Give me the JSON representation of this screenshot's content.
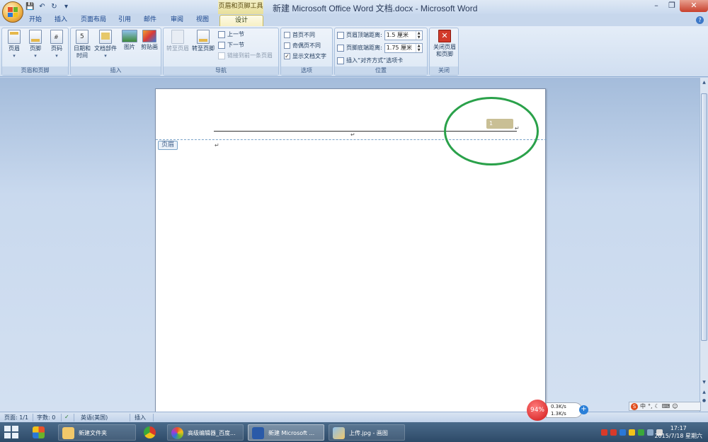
{
  "title_bar": {
    "contextual_tab_label": "页眉和页脚工具",
    "window_title": "新建 Microsoft Office Word 文档.docx - Microsoft Word",
    "minimize": "–",
    "restore": "❐",
    "close": "✕"
  },
  "quick_access": {
    "save": "💾",
    "undo": "↶",
    "redo": "↻",
    "customize": "▾"
  },
  "tabs": [
    {
      "label": "开始"
    },
    {
      "label": "插入"
    },
    {
      "label": "页面布局"
    },
    {
      "label": "引用"
    },
    {
      "label": "邮件"
    },
    {
      "label": "审阅"
    },
    {
      "label": "视图"
    },
    {
      "label": "设计",
      "active": true
    }
  ],
  "ribbon": {
    "header_footer_group": {
      "label": "页眉和页脚",
      "header": "页眉",
      "footer": "页脚",
      "page_number": "页码"
    },
    "insert_group": {
      "label": "插入",
      "date_time_line1": "日期和",
      "date_time_line2": "时间",
      "quick_parts": "文档部件",
      "picture": "图片",
      "clip_art": "剪贴画"
    },
    "navigation_group": {
      "label": "导航",
      "goto_header": "转至页眉",
      "goto_footer": "转至页脚",
      "prev_section": "上一节",
      "next_section": "下一节",
      "link_previous": "链接到前一条页眉"
    },
    "options_group": {
      "label": "选项",
      "different_first_page": "首页不同",
      "different_odd_even": "奇偶页不同",
      "show_document_text": "显示文档文字",
      "show_document_text_checked": "✓"
    },
    "position_group": {
      "label": "位置",
      "header_from_top_label": "页眉顶端距离:",
      "header_from_top_value": "1.5 厘米",
      "footer_from_bottom_label": "页脚底端距离:",
      "footer_from_bottom_value": "1.75 厘米",
      "insert_alignment_tab": "插入“对齐方式”选项卡"
    },
    "close_group": {
      "label": "关闭",
      "close_line1": "关闭页眉",
      "close_line2": "和页脚"
    }
  },
  "document": {
    "header_tag": "页眉",
    "page_number_field": "1",
    "paragraph_mark": "↵"
  },
  "status_bar": {
    "page": "页面: 1/1",
    "words": "字数: 0",
    "language": "英语(美国)",
    "mode": "插入"
  },
  "taskbar": {
    "apps": [
      {
        "label": ""
      },
      {
        "label": "新建文件夹"
      },
      {
        "label": ""
      },
      {
        "label": "高级编辑器_百度..."
      },
      {
        "label": "新建 Microsoft ..."
      },
      {
        "label": "上传.jpg - 画图"
      }
    ],
    "speed_percent": "94%",
    "upload_speed": "0.3K/s",
    "download_speed": "1.3K/s",
    "clock_time": "17:17",
    "clock_date": "2015/7/18 星期六"
  },
  "colors": {
    "contextual_tab": "#e8df9a",
    "highlight_circle": "#2aa14a",
    "close_button": "#c8402c",
    "close_ribbon_icon": "#d23a2a"
  }
}
